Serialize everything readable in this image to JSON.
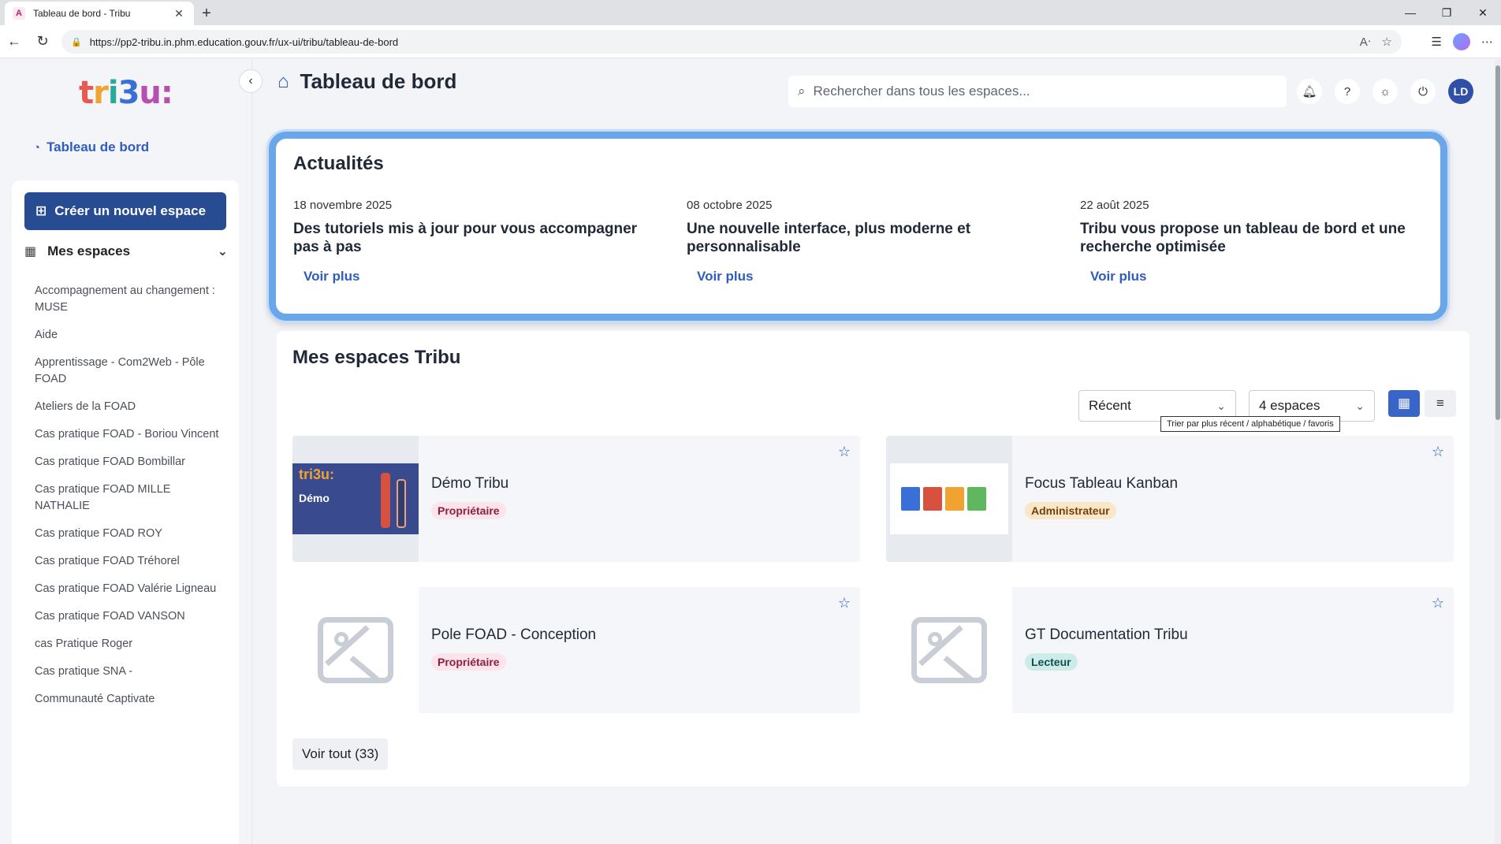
{
  "browser": {
    "tab_title": "Tableau de bord - Tribu",
    "url": "https://pp2-tribu.in.phm.education.gouv.fr/ux-ui/tribu/tableau-de-bord"
  },
  "sidebar": {
    "dashboard_link": "Tableau de bord",
    "create_button": "Créer un nouvel espace",
    "my_spaces_label": "Mes espaces",
    "spaces": [
      "Accompagnement au changement : MUSE",
      "Aide",
      "Apprentissage - Com2Web - Pôle FOAD",
      "Ateliers de la FOAD",
      "Cas pratique FOAD - Boriou Vincent",
      "Cas pratique FOAD Bombillar",
      "Cas pratique FOAD MILLE NATHALIE",
      "Cas pratique FOAD ROY",
      "Cas pratique FOAD Tréhorel",
      "Cas pratique FOAD Valérie Ligneau",
      "Cas pratique FOAD VANSON",
      "cas Pratique Roger",
      "Cas pratique SNA -",
      "Communauté Captivate"
    ]
  },
  "header": {
    "title": "Tableau de bord",
    "search_placeholder": "Rechercher dans tous les espaces...",
    "avatar_initials": "LD"
  },
  "news": {
    "title": "Actualités",
    "items": [
      {
        "date": "18 novembre 2025",
        "headline": "Des tutoriels mis à jour pour vous accompagner pas à pas",
        "more": "Voir plus"
      },
      {
        "date": "08 octobre 2025",
        "headline": "Une nouvelle interface, plus moderne et personnalisable",
        "more": "Voir plus"
      },
      {
        "date": "22 août 2025",
        "headline": "Tribu vous propose un tableau de bord et une recherche optimisée",
        "more": "Voir plus"
      }
    ]
  },
  "spaces_section": {
    "title": "Mes espaces Tribu",
    "sort_value": "Récent",
    "count_value": "4 espaces",
    "tooltip": "Trier par plus récent / alphabétique / favoris",
    "see_all": "Voir tout (33)",
    "thumb_logo": "tri3u:",
    "thumb_demo_text": "Démo",
    "cards": [
      {
        "name": "Démo Tribu",
        "role": "Propriétaire",
        "role_bg": "#fde4ea",
        "role_color": "#8a2040"
      },
      {
        "name": "Focus Tableau Kanban",
        "role": "Administrateur",
        "role_bg": "#fbe6c6",
        "role_color": "#6b4410"
      },
      {
        "name": "Pole FOAD - Conception",
        "role": "Propriétaire",
        "role_bg": "#fde4ea",
        "role_color": "#8a2040"
      },
      {
        "name": "GT Documentation Tribu",
        "role": "Lecteur",
        "role_bg": "#cdece9",
        "role_color": "#0f4f4a"
      }
    ]
  },
  "colors": {
    "primary": "#274c91",
    "accent": "#2f5cc0",
    "news_border": "#6aa6ea"
  }
}
